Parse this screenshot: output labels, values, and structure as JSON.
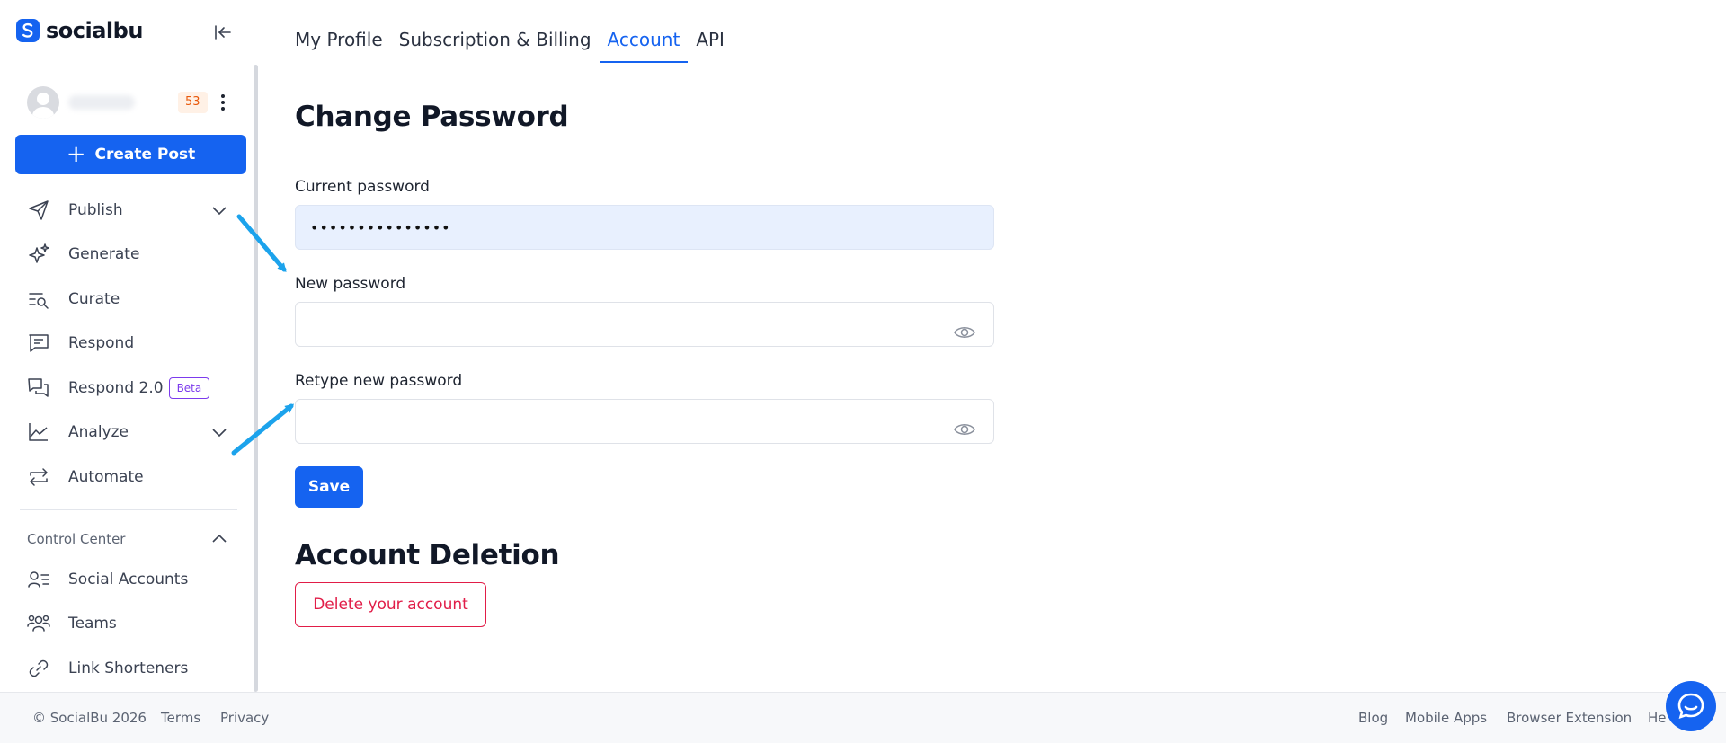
{
  "brand": {
    "name": "socialbu",
    "accent": "#1563f0"
  },
  "user": {
    "notification_count": "53"
  },
  "sidebar": {
    "create_post_label": "Create Post",
    "items": [
      {
        "label": "Publish",
        "icon": "send-icon",
        "has_chevron": true
      },
      {
        "label": "Generate",
        "icon": "sparkles-icon"
      },
      {
        "label": "Curate",
        "icon": "list-search-icon"
      },
      {
        "label": "Respond",
        "icon": "message-square-icon"
      },
      {
        "label": "Respond 2.0",
        "icon": "messages-icon",
        "badge": "Beta"
      },
      {
        "label": "Analyze",
        "icon": "line-chart-icon",
        "has_chevron": true
      },
      {
        "label": "Automate",
        "icon": "repeat-icon"
      }
    ],
    "control_center": {
      "label": "Control Center",
      "items": [
        {
          "label": "Social Accounts",
          "icon": "user-list-icon"
        },
        {
          "label": "Teams",
          "icon": "users-icon"
        },
        {
          "label": "Link Shorteners",
          "icon": "link-icon"
        }
      ]
    }
  },
  "tabs": [
    {
      "label": "My Profile",
      "active": false
    },
    {
      "label": "Subscription & Billing",
      "active": false
    },
    {
      "label": "Account",
      "active": true
    },
    {
      "label": "API",
      "active": false
    }
  ],
  "change_password": {
    "title": "Change Password",
    "current_label": "Current password",
    "current_value": "•••••••••••••••",
    "new_label": "New password",
    "retype_label": "Retype new password",
    "save_label": "Save"
  },
  "account_deletion": {
    "title": "Account Deletion",
    "delete_label": "Delete your account"
  },
  "footer": {
    "copyright": "© SocialBu 2026",
    "left_links": [
      "Terms",
      "Privacy"
    ],
    "right_links": [
      "Blog",
      "Mobile Apps",
      "Browser Extension",
      "He"
    ]
  }
}
